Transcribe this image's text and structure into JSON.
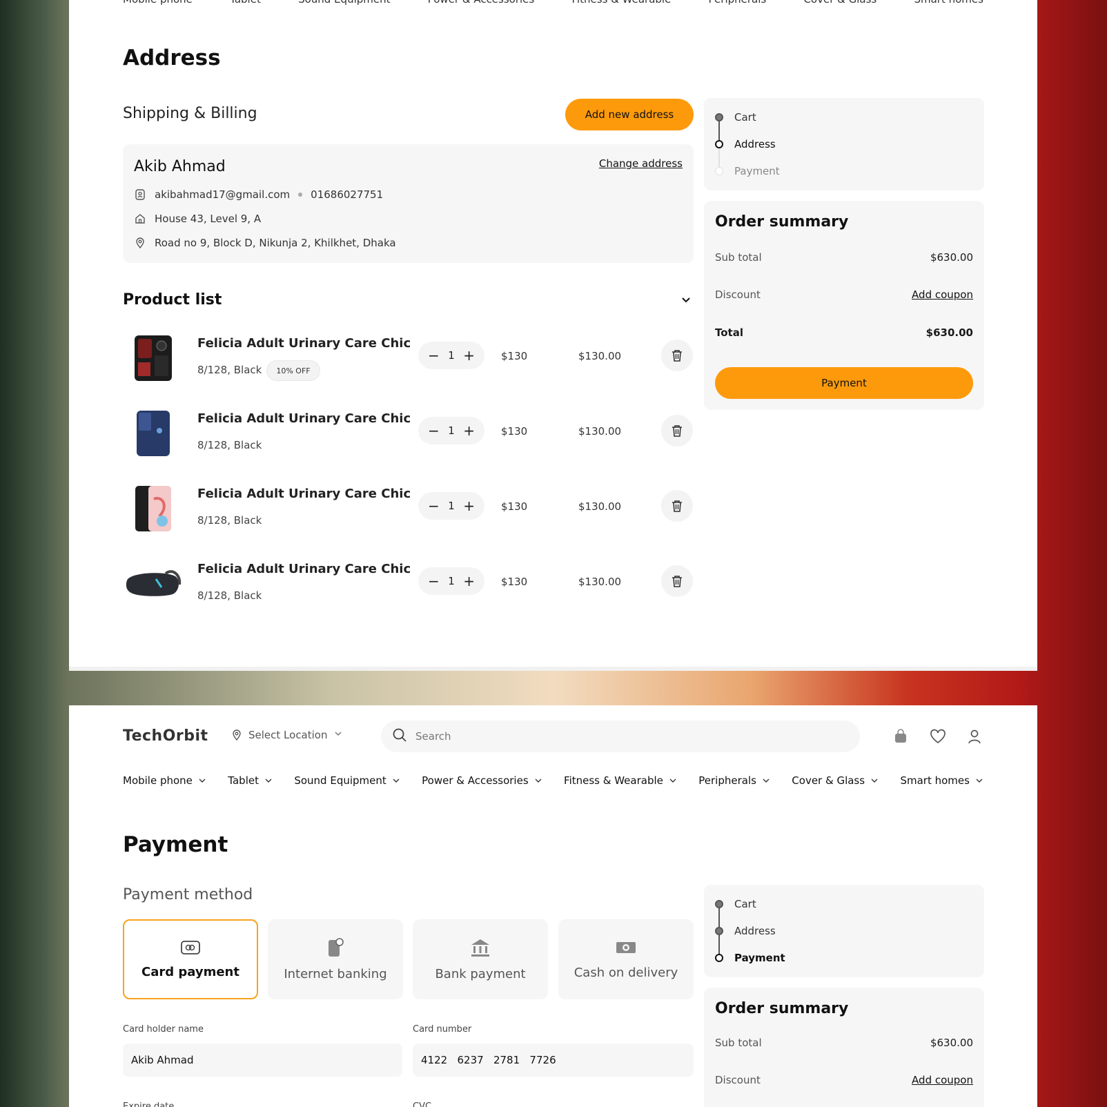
{
  "address_page": {
    "nav_fragments": [
      "Mobile phone",
      "Tablet",
      "Sound Equipment",
      "Power & Accessories",
      "Fitness & Wearable",
      "Peripherals",
      "Cover & Glass",
      "Smart homes"
    ],
    "title": "Address",
    "shipping_title": "Shipping & Billing",
    "add_address_label": "Add new address",
    "contact": {
      "name": "Akib Ahmad",
      "change_label": "Change address",
      "email": "akibahmad17@gmail.com",
      "phone": "01686027751",
      "address_line1": "House 43, Level 9, A",
      "address_line2": "Road no 9, Block D, Nikunja 2, Khilkhet, Dhaka"
    },
    "product_list_title": "Product list",
    "products": [
      {
        "name": "Felicia Adult Urinary Care Chick...",
        "variant": "8/128, Black",
        "badge": "10% OFF",
        "qty": "1",
        "unit_price": "$130",
        "total": "$130.00",
        "image": "phone-red-icon"
      },
      {
        "name": "Felicia Adult Urinary Care Chick...",
        "variant": "8/128, Black",
        "qty": "1",
        "unit_price": "$130",
        "total": "$130.00",
        "image": "phone-blue-icon"
      },
      {
        "name": "Felicia Adult Urinary Care Chick...",
        "variant": "8/128, Black",
        "qty": "1",
        "unit_price": "$130",
        "total": "$130.00",
        "image": "phone-pink-icon"
      },
      {
        "name": "Felicia Adult Urinary Care Chick...",
        "variant": "8/128, Black",
        "qty": "1",
        "unit_price": "$130",
        "total": "$130.00",
        "image": "vr-headset-icon"
      }
    ],
    "steps": [
      {
        "label": "Cart",
        "state": "done"
      },
      {
        "label": "Address",
        "state": "current"
      },
      {
        "label": "Payment",
        "state": "pending"
      }
    ],
    "summary": {
      "title": "Order summary",
      "subtotal_label": "Sub total",
      "subtotal_value": "$630.00",
      "discount_label": "Discount",
      "coupon_label": "Add coupon",
      "total_label": "Total",
      "total_value": "$630.00",
      "pay_button": "Payment"
    }
  },
  "payment_page": {
    "logo": "TechOrbit",
    "location_label": "Select Location",
    "search_placeholder": "Search",
    "nav": [
      "Mobile phone",
      "Tablet",
      "Sound Equipment",
      "Power & Accessories",
      "Fitness & Wearable",
      "Peripherals",
      "Cover & Glass",
      "Smart homes"
    ],
    "title": "Payment",
    "method_title": "Payment method",
    "methods": [
      {
        "label": "Card payment",
        "icon": "card-icon",
        "active": true
      },
      {
        "label": "Internet banking",
        "icon": "mobile-banking-icon",
        "active": false
      },
      {
        "label": "Bank payment",
        "icon": "bank-icon",
        "active": false
      },
      {
        "label": "Cash on delivery",
        "icon": "cash-icon",
        "active": false
      }
    ],
    "card_holder_label": "Card holder name",
    "card_holder_value": "Akib Ahmad",
    "card_number_label": "Card number",
    "card_number_value": "4122   6237   2781   7726",
    "expire_label": "Expire date",
    "cvc_label": "CVC",
    "steps": [
      {
        "label": "Cart",
        "state": "done"
      },
      {
        "label": "Address",
        "state": "done"
      },
      {
        "label": "Payment",
        "state": "current"
      }
    ],
    "summary": {
      "title": "Order summary",
      "subtotal_label": "Sub total",
      "subtotal_value": "$630.00",
      "discount_label": "Discount",
      "coupon_label": "Add coupon"
    }
  },
  "colors": {
    "accent": "#fd9a0c",
    "panel": "#f6f6f6"
  }
}
